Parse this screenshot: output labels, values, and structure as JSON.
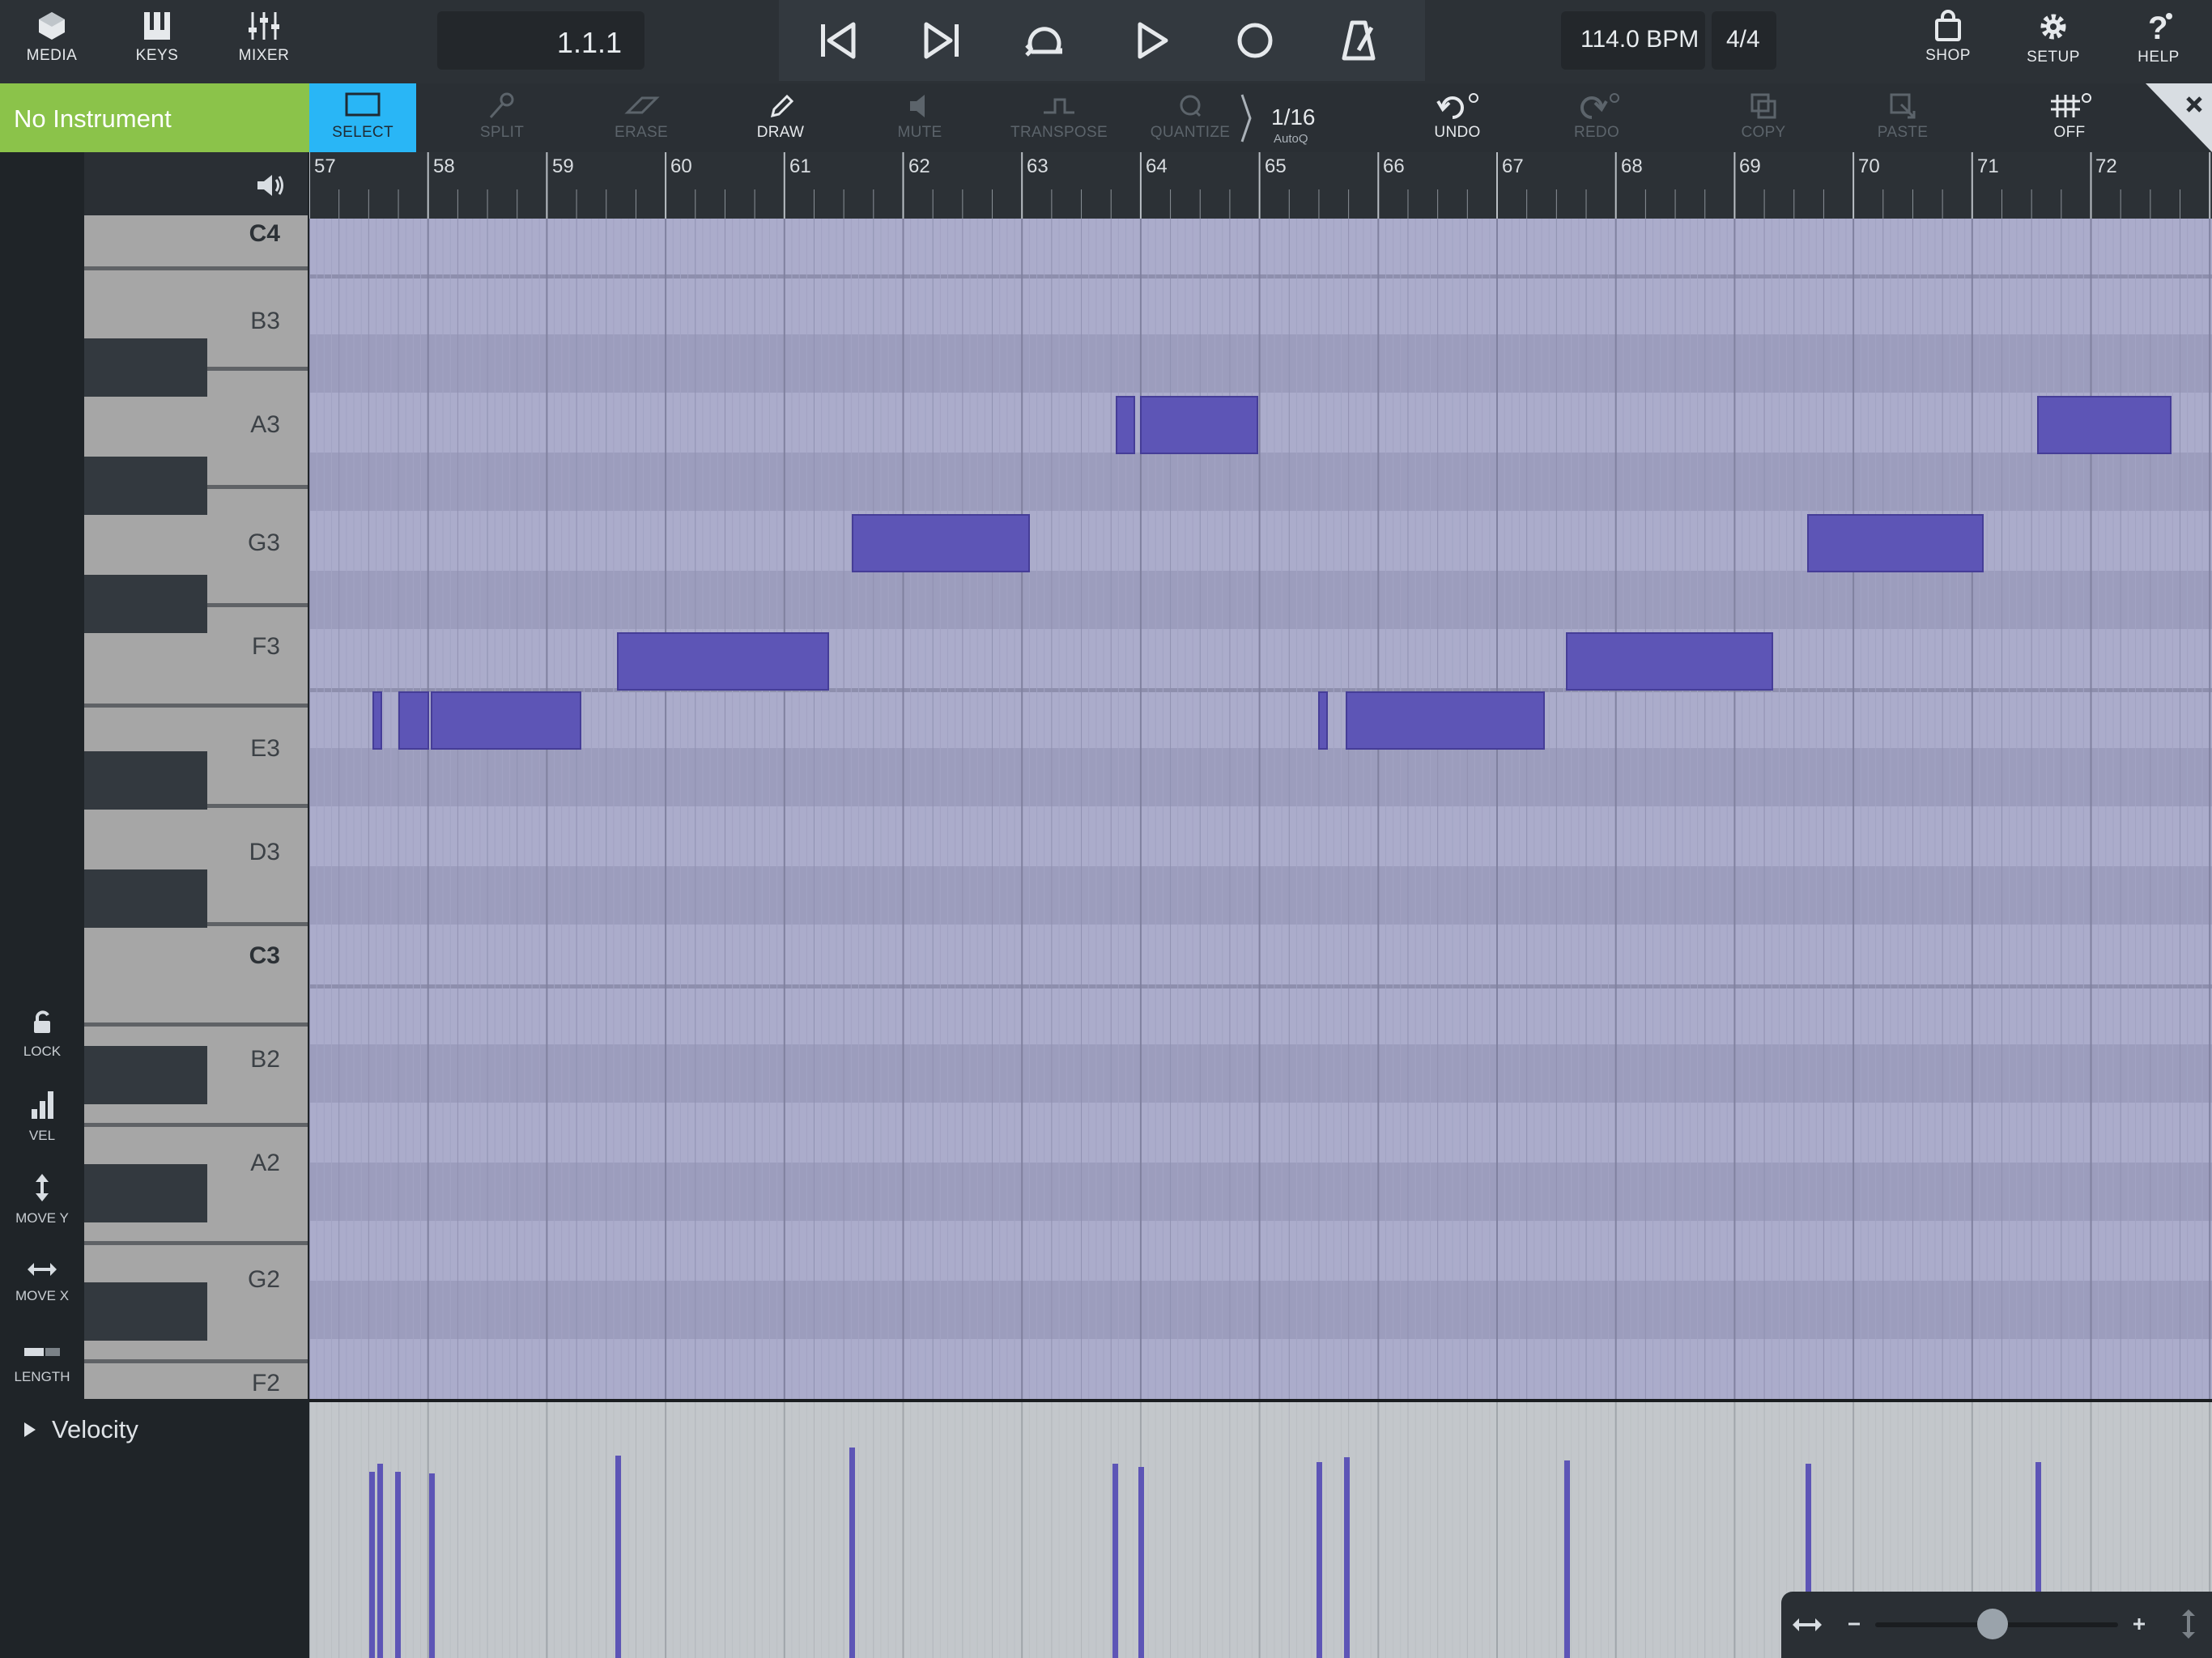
{
  "top_bar": {
    "media_label": "MEDIA",
    "keys_label": "KEYS",
    "mixer_label": "MIXER",
    "position": "1.1.1",
    "bpm": "114.0 BPM",
    "time_signature": "4/4",
    "shop_label": "SHOP",
    "setup_label": "SETUP",
    "help_label": "HELP"
  },
  "toolbar": {
    "instrument": "No Instrument",
    "select": "SELECT",
    "split": "SPLIT",
    "erase": "ERASE",
    "draw": "DRAW",
    "mute": "MUTE",
    "transpose": "TRANSPOSE",
    "quantize": "QUANTIZE",
    "quantize_value": "1/16",
    "quantize_sub": "AutoQ",
    "undo": "UNDO",
    "redo": "REDO",
    "copy": "COPY",
    "paste": "PASTE",
    "snap": "OFF"
  },
  "side_tools": {
    "lock": "LOCK",
    "vel": "VEL",
    "move_y": "MOVE Y",
    "move_x": "MOVE X",
    "length": "LENGTH"
  },
  "keyboard": {
    "labels": [
      "C4",
      "B3",
      "A3",
      "G3",
      "F3",
      "E3",
      "D3",
      "C3",
      "B2",
      "A2",
      "G2",
      "F2"
    ]
  },
  "ruler": {
    "bars": [
      "57",
      "58",
      "59",
      "60",
      "61",
      "62",
      "63",
      "64",
      "65",
      "66",
      "67",
      "68",
      "69",
      "70",
      "71",
      "72"
    ]
  },
  "velocity": {
    "label": "Velocity"
  },
  "colors": {
    "accent": "#29b6f6",
    "instrument": "#8bc34a",
    "note": "#5d55b6",
    "grid": "#abaccb"
  },
  "icons": [
    "media-icon",
    "keys-icon",
    "mixer-icon",
    "rewind-icon",
    "skip-end-icon",
    "loop-icon",
    "play-icon",
    "record-icon",
    "metronome-icon",
    "shop-icon",
    "gear-icon",
    "help-icon",
    "speaker-icon",
    "lock-icon",
    "velocity-icon",
    "move-y-icon",
    "move-x-icon",
    "length-icon",
    "close-icon"
  ]
}
